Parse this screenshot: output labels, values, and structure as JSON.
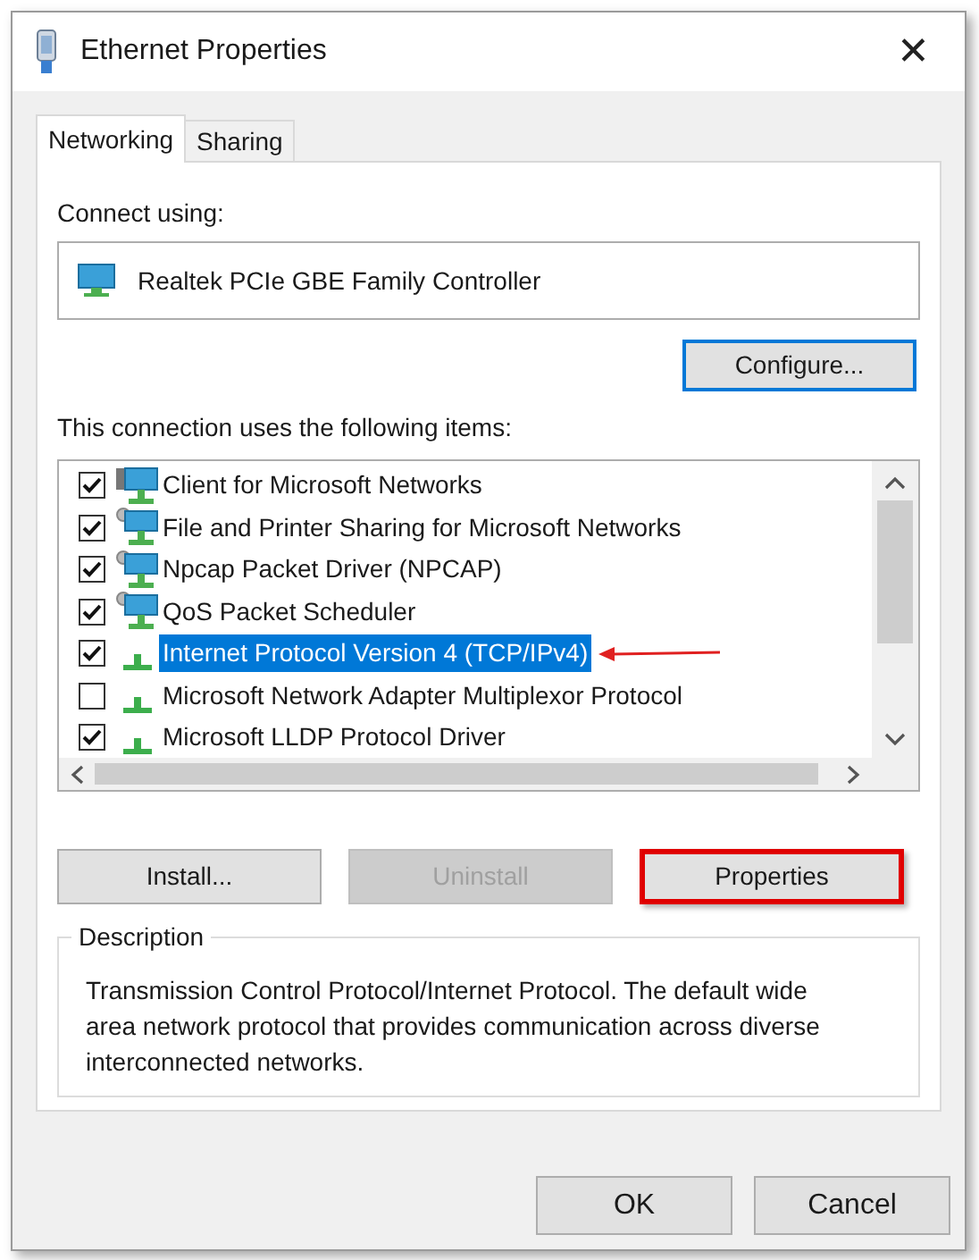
{
  "window": {
    "title": "Ethernet Properties",
    "close": "✕"
  },
  "tabs": [
    {
      "label": "Networking",
      "selected": true
    },
    {
      "label": "Sharing",
      "selected": false
    }
  ],
  "connect_using": {
    "label": "Connect using:",
    "adapter": "Realtek PCIe GBE Family Controller",
    "configure_button": "Configure..."
  },
  "items_label": "This connection uses the following items:",
  "items": [
    {
      "label": "Client for Microsoft Networks",
      "kind": "client",
      "checked": true,
      "selected": false,
      "annotated": false
    },
    {
      "label": "File and Printer Sharing for Microsoft Networks",
      "kind": "service",
      "checked": true,
      "selected": false,
      "annotated": false
    },
    {
      "label": "Npcap Packet Driver (NPCAP)",
      "kind": "service",
      "checked": true,
      "selected": false,
      "annotated": false
    },
    {
      "label": "QoS Packet Scheduler",
      "kind": "service",
      "checked": true,
      "selected": false,
      "annotated": false
    },
    {
      "label": "Internet Protocol Version 4 (TCP/IPv4)",
      "kind": "protocol",
      "checked": true,
      "selected": true,
      "annotated": true
    },
    {
      "label": "Microsoft Network Adapter Multiplexor Protocol",
      "kind": "protocol",
      "checked": false,
      "selected": false,
      "annotated": false
    },
    {
      "label": "Microsoft LLDP Protocol Driver",
      "kind": "protocol",
      "checked": true,
      "selected": false,
      "annotated": false
    }
  ],
  "item_buttons": [
    {
      "label": "Install...",
      "disabled": false,
      "annotated": false
    },
    {
      "label": "Uninstall",
      "disabled": true,
      "annotated": false
    },
    {
      "label": "Properties",
      "disabled": false,
      "annotated": true
    }
  ],
  "description": {
    "title": "Description",
    "text": "Transmission Control Protocol/Internet Protocol. The default wide area network protocol that provides communication across diverse interconnected networks."
  },
  "dialog_buttons": [
    {
      "label": "OK"
    },
    {
      "label": "Cancel"
    }
  ]
}
